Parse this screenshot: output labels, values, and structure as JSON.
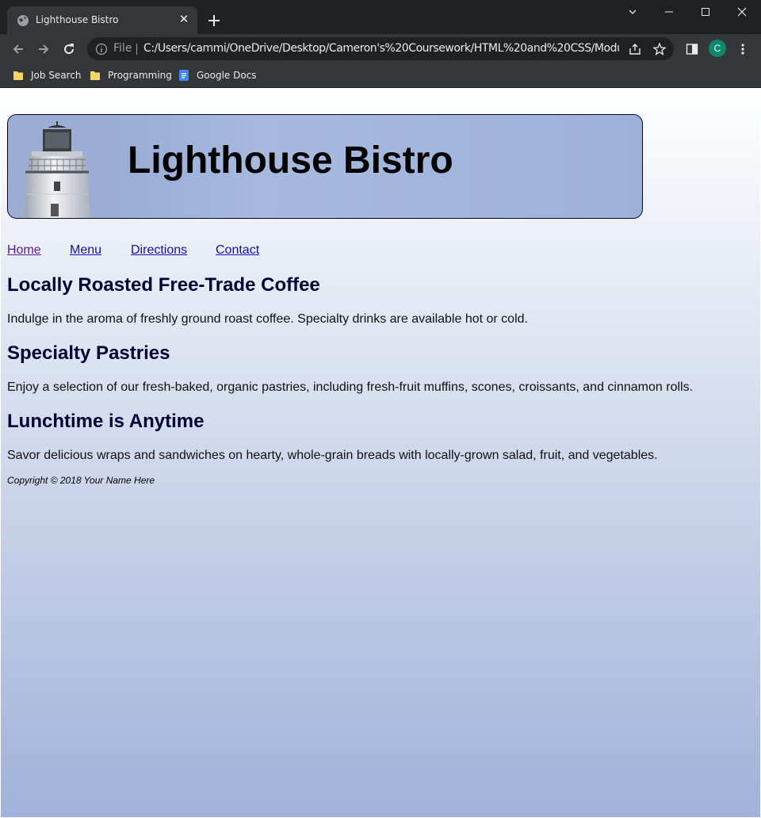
{
  "browser": {
    "tab_title": "Lighthouse Bistro",
    "omnibox_scheme": "File",
    "url": "C:/Users/cammi/OneDrive/Desktop/Cameron's%20Coursework/HTML%20and%20CSS/Module...",
    "profile_initial": "C",
    "bookmarks": [
      "Job Search",
      "Programming",
      "Google Docs"
    ]
  },
  "header": {
    "title": "Lighthouse Bistro"
  },
  "nav": {
    "items": [
      "Home",
      "Menu",
      "Directions",
      "Contact"
    ]
  },
  "sections": [
    {
      "heading": "Locally Roasted Free-Trade Coffee",
      "text": "Indulge in the aroma of freshly ground roast coffee. Specialty drinks are available hot or cold."
    },
    {
      "heading": "Specialty Pastries",
      "text": "Enjoy a selection of our fresh-baked, organic pastries, including fresh-fruit muffins, scones, croissants, and cinnamon rolls."
    },
    {
      "heading": "Lunchtime is Anytime",
      "text": "Savor delicious wraps and sandwiches on hearty, whole-grain breads with locally-grown salad, fruit, and vegetables."
    }
  ],
  "footer": {
    "text": "Copyright © 2018 Your Name Here"
  },
  "colors": {
    "heading": "#000033",
    "chrome_dark": "#202124",
    "chrome": "#35363a",
    "profile": "#0b8a6e"
  }
}
